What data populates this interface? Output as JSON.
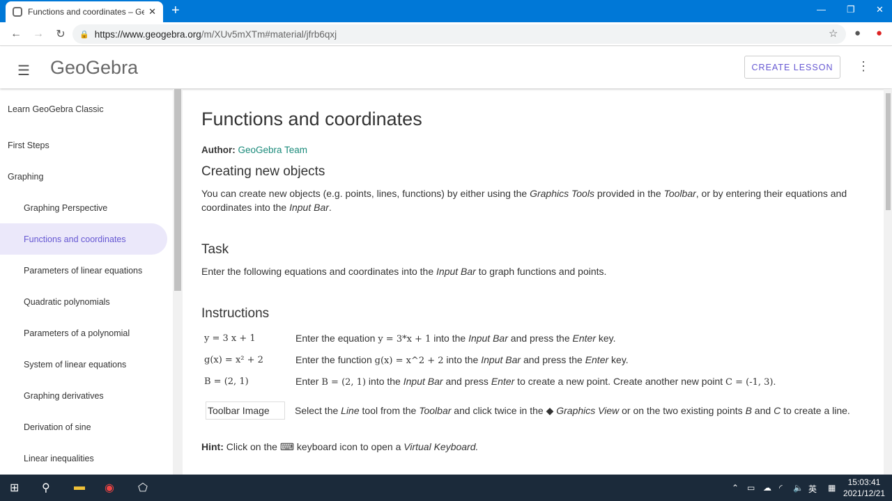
{
  "browser": {
    "tab_title": "Functions and coordinates – GeoGebra",
    "url_domain": "https://www.geogebra.org",
    "url_path": "/m/XUv5mXTm#material/jfrb6qxj"
  },
  "header": {
    "logo": "GeoGebra",
    "create_lesson": "CREATE LESSON"
  },
  "sidebar": {
    "items": [
      {
        "label": "Learn GeoGebra Classic",
        "sub": false
      },
      {
        "label": "First Steps",
        "sub": false
      },
      {
        "label": "Graphing",
        "sub": false
      },
      {
        "label": "Graphing Perspective",
        "sub": true
      },
      {
        "label": "Functions and coordinates",
        "sub": true,
        "active": true
      },
      {
        "label": "Parameters of linear equations",
        "sub": true
      },
      {
        "label": "Quadratic polynomials",
        "sub": true
      },
      {
        "label": "Parameters of a polynomial",
        "sub": true
      },
      {
        "label": "System of linear equations",
        "sub": true
      },
      {
        "label": "Graphing derivatives",
        "sub": true
      },
      {
        "label": "Derivation of sine",
        "sub": true
      },
      {
        "label": "Linear inequalities",
        "sub": true
      }
    ]
  },
  "main": {
    "title": "Functions and coordinates",
    "author_label": "Author:",
    "author": "GeoGebra Team",
    "h_create": "Creating new objects",
    "p_create": [
      [
        "You can create new objects (e.g. points, lines, functions) by either using the ",
        0
      ],
      [
        "Graphics Tools",
        1
      ],
      [
        " provided in the ",
        0
      ],
      [
        "Toolbar",
        1
      ],
      [
        ", or by entering their equations and coordinates into the ",
        0
      ],
      [
        "Input Bar",
        1
      ],
      [
        ".",
        0
      ]
    ],
    "h_task": "Task",
    "p_task": [
      [
        "Enter the following equations and coordinates into the ",
        0
      ],
      [
        "Input Bar",
        1
      ],
      [
        " to graph functions and points.",
        0
      ]
    ],
    "h_instr": "Instructions",
    "instructions": [
      {
        "label": "y = 3 x + 1",
        "text": [
          [
            "Enter the equation ",
            0
          ],
          [
            "y = 3*x + 1",
            2
          ],
          [
            " into the ",
            0
          ],
          [
            "Input Bar",
            1
          ],
          [
            " and press the ",
            0
          ],
          [
            "Enter",
            1
          ],
          [
            " key.",
            0
          ]
        ]
      },
      {
        "label": "g(x) = x² + 2",
        "text": [
          [
            "Enter the function ",
            0
          ],
          [
            "g(x) = x^2 + 2",
            2
          ],
          [
            " into the ",
            0
          ],
          [
            "Input Bar",
            1
          ],
          [
            " and press the ",
            0
          ],
          [
            "Enter",
            1
          ],
          [
            " key.",
            0
          ]
        ]
      },
      {
        "label": "B = (2, 1)",
        "text": [
          [
            "Enter ",
            0
          ],
          [
            "B = (2, 1)",
            2
          ],
          [
            " into the ",
            0
          ],
          [
            "Input Bar",
            1
          ],
          [
            " and press ",
            0
          ],
          [
            "Enter",
            1
          ],
          [
            " to create a new point. Create another new point ",
            0
          ],
          [
            "C = (-1, 3)",
            2
          ],
          [
            ".",
            0
          ]
        ]
      },
      {
        "label": "Toolbar Image",
        "text": [
          [
            "Select the ",
            0
          ],
          [
            "Line",
            1
          ],
          [
            " tool from the ",
            0
          ],
          [
            "Toolbar",
            1
          ],
          [
            " and click twice in the ◆ ",
            0
          ],
          [
            "Graphics View",
            1
          ],
          [
            " or on the two existing points ",
            0
          ],
          [
            "B",
            1
          ],
          [
            " and ",
            0
          ],
          [
            "C",
            1
          ],
          [
            " to create a line.",
            0
          ]
        ]
      }
    ],
    "hint": [
      [
        "Hint:",
        3
      ],
      [
        " Click on the ⌨ keyboard icon to open a ",
        0
      ],
      [
        "Virtual Keyboard.",
        1
      ]
    ]
  },
  "taskbar": {
    "time": "15:03:41",
    "date": "2021/12/21",
    "ime": "英"
  }
}
